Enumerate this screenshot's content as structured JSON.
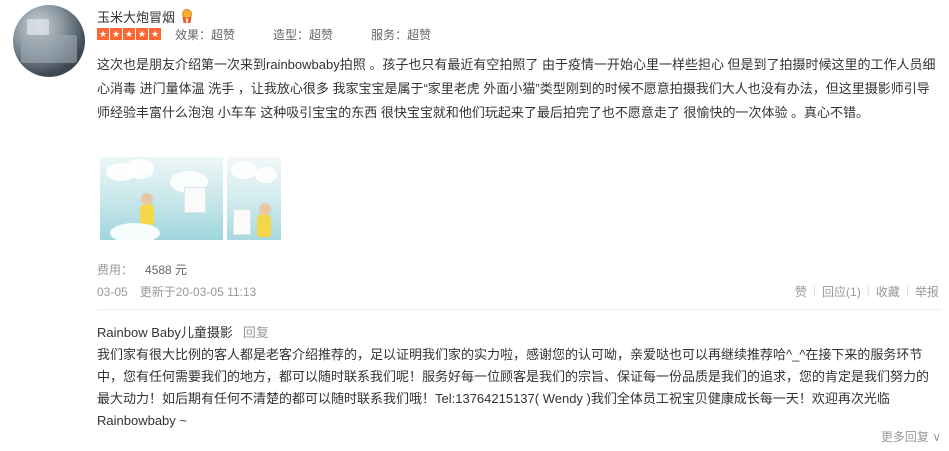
{
  "user": {
    "name": "玉米大炮冒烟",
    "ratings": [
      {
        "label": "效果：",
        "value": "超赞"
      },
      {
        "label": "造型：",
        "value": "超赞"
      },
      {
        "label": "服务：",
        "value": "超赞"
      }
    ],
    "stars": 5
  },
  "review": {
    "text": "这次也是朋友介绍第一次来到rainbowbaby拍照 。孩子也只有最近有空拍照了 由于疫情一开始心里一样些担心 但是到了拍摄时候这里的工作人员细心消毒 进门量体温 洗手 ，让我放心很多 我家宝宝是属于“家里老虎 外面小猫”类型刚到的时候不愿意拍摄我们大人也没有办法，但这里摄影师引导师经验丰富什么泡泡 小车车 这种吸引宝宝的东西 很快宝宝就和他们玩起来了最后拍完了也不愿意走了 很愉快的一次体验 。真心不错。",
    "fee_label": "费用：",
    "fee_value": "4588 元",
    "date": "03-05",
    "updated": "更新于20-03-05 11:13"
  },
  "actions": {
    "like": "赞",
    "reply": "回应(1)",
    "favorite": "收藏",
    "report": "举报"
  },
  "merchant_reply": {
    "name": "Rainbow Baby儿童摄影",
    "reply_label": "回复",
    "text": "我们家有很大比例的客人都是老客介绍推荐的，足以证明我们家的实力啦，感谢您的认可呦，亲爱哒也可以再继续推荐哈^_^在接下来的服务环节中，您有任何需要我们的地方，都可以随时联系我们呢！服务好每一位顾客是我们的宗旨、保证每一份品质是我们的追求，您的肯定是我们努力的最大动力！如后期有任何不清楚的都可以随时联系我们哦！Tel:13764215137( Wendy )我们全体员工祝宝贝健康成长每一天！欢迎再次光临Rainbowbaby ~"
  },
  "more_replies": "更多回复 ∨"
}
